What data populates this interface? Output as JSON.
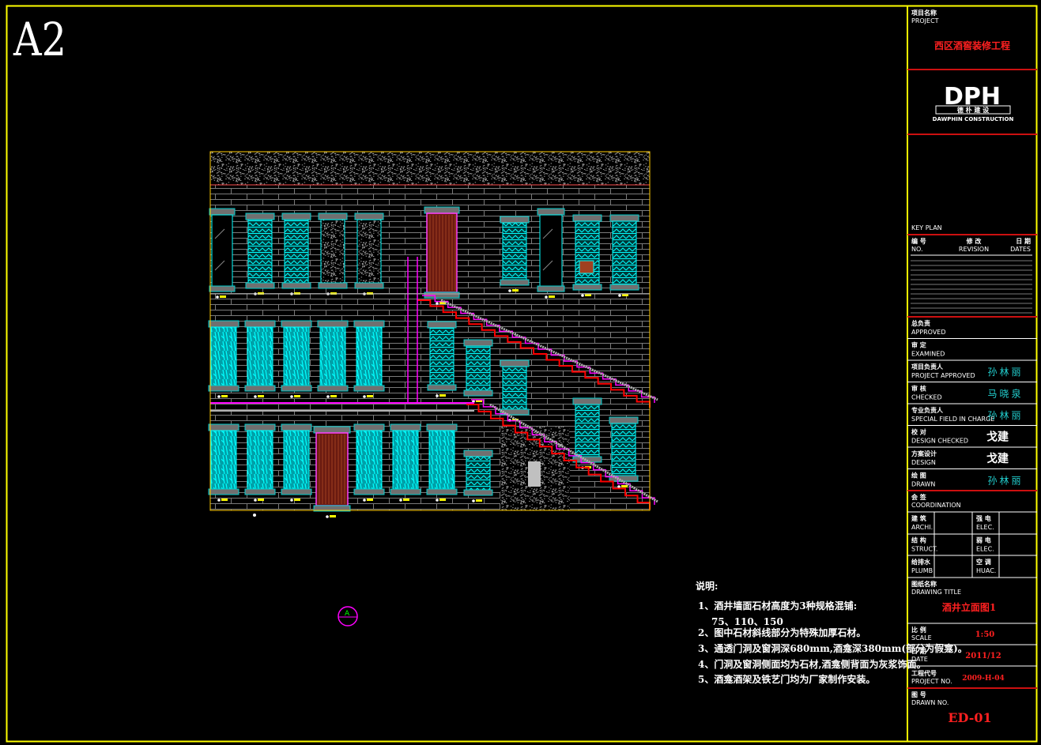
{
  "sheet": {
    "size_label": "A2"
  },
  "colors": {
    "frame": "#ffff00",
    "divider": "#cc1010",
    "glass": "#00ffff",
    "stair_red": "#ff0000",
    "stair_magenta": "#ff00ff",
    "brick": "#8a8a8a"
  },
  "title_block": {
    "project": {
      "cn": "项目名称",
      "en": "PROJECT",
      "value": "西区酒窖装修工程"
    },
    "logo": {
      "mark": "DPH",
      "cn": "德 朴 建 设",
      "en": "DAWPHIN CONSTRUCTION"
    },
    "key_plan": "KEY PLAN",
    "revision_header": {
      "no_cn": "编 号",
      "no_en": "NO.",
      "rev_cn": "修 改",
      "rev_en": "REVISION",
      "date_cn": "日 期",
      "date_en": "DATES"
    },
    "signoffs": [
      {
        "cn": "总负责",
        "en": "APPROVED",
        "sign": ""
      },
      {
        "cn": "审 定",
        "en": "EXAMINED",
        "sign": ""
      },
      {
        "cn": "项目负责人",
        "en": "PROJECT APPROVED",
        "sign": "孙林丽"
      },
      {
        "cn": "审 核",
        "en": "CHECKED",
        "sign": "马晓泉"
      },
      {
        "cn": "专业负责人",
        "en": "SPECIAL FIELD IN CHARGE",
        "sign": "孙林丽"
      },
      {
        "cn": "校 对",
        "en": "DESIGN CHECKED",
        "sign": "戈建"
      },
      {
        "cn": "方案设计",
        "en": "DESIGN",
        "sign": "戈建"
      },
      {
        "cn": "绘 图",
        "en": "DRAWN",
        "sign": "孙林丽"
      }
    ],
    "coordination": {
      "cn": "会 签",
      "en": "COORDINATION",
      "cells": [
        {
          "cn": "建 筑",
          "en": "ARCHI."
        },
        {
          "cn": "强 电",
          "en": "ELEC."
        },
        {
          "cn": "结 构",
          "en": "STRUCT."
        },
        {
          "cn": "弱 电",
          "en": "ELEC."
        },
        {
          "cn": "给排水",
          "en": "PLUMB"
        },
        {
          "cn": "空 调",
          "en": "HUAC."
        }
      ]
    },
    "drawing_title": {
      "cn": "图纸名称",
      "en": "DRAWING TITLE",
      "value": "酒井立面图1"
    },
    "scale": {
      "cn": "比 例",
      "en": "SCALE",
      "value": "1:50"
    },
    "date": {
      "cn": "日 期",
      "en": "DATE",
      "value": "2011/12"
    },
    "project_no": {
      "cn": "工程代号",
      "en": "PROJECT NO.",
      "value": "2009-H-04"
    },
    "drawing_no": {
      "cn": "图 号",
      "en": "DRAWN NO.",
      "value": "ED-01"
    }
  },
  "notes": {
    "heading": "说明:",
    "items": [
      "1、酒井墙面石材高度为3种规格混铺:",
      "75、110、150",
      "2、图中石材斜线部分为特殊加厚石材。",
      "3、通透门洞及窗洞深680mm,酒龛深380mm(部分为假龛)。",
      "4、门洞及窗洞侧面均为石材,酒龛侧背面为灰浆饰面。",
      "5、酒龛酒架及铁艺门均为厂家制作安装。"
    ]
  },
  "section_marker": {
    "letter": "A"
  }
}
